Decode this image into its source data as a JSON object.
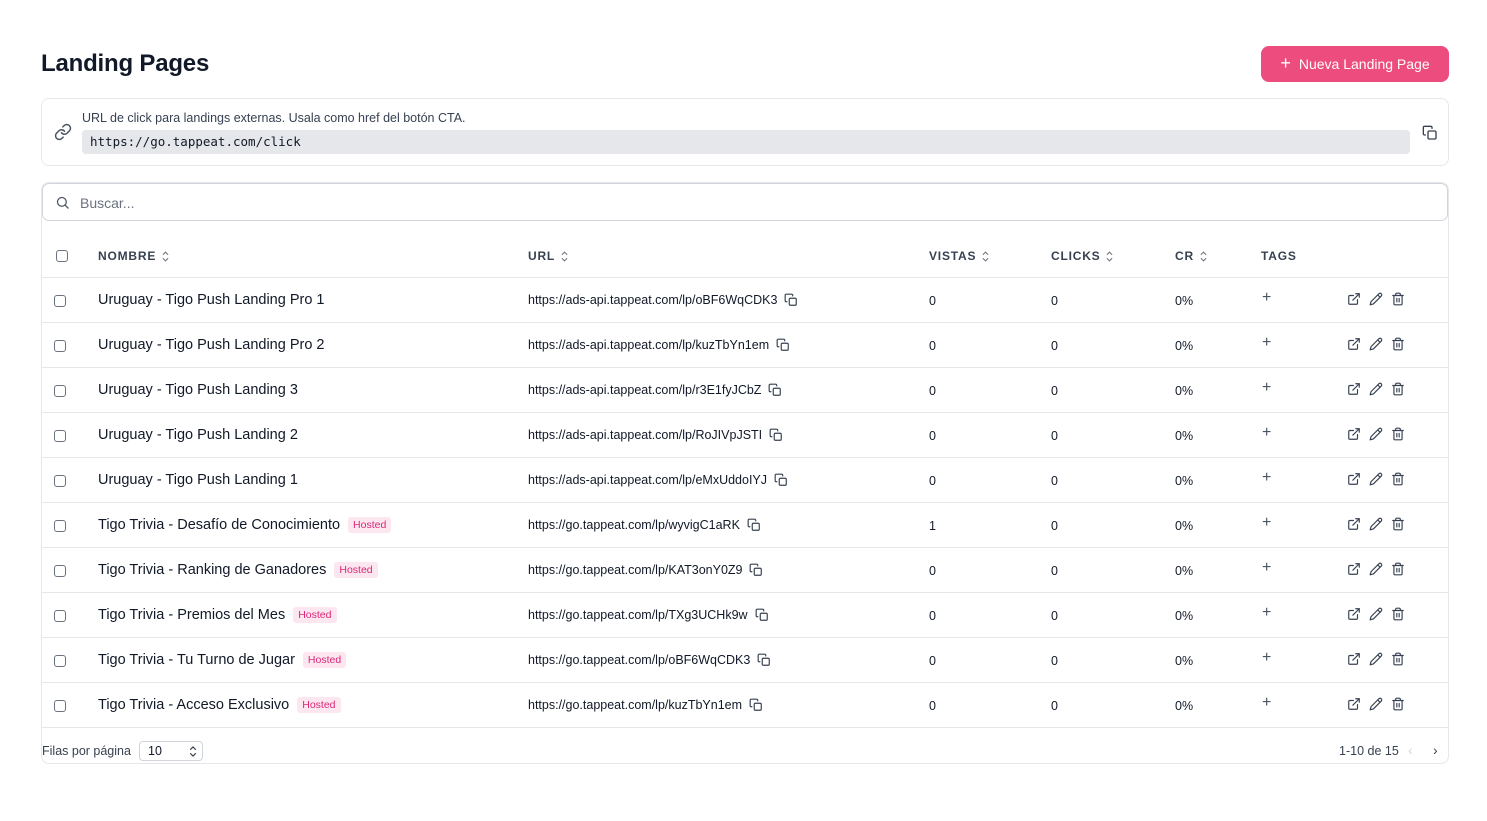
{
  "header": {
    "title": "Landing Pages",
    "new_button_label": "Nueva Landing Page"
  },
  "click_url_card": {
    "hint": "URL de click para landings externas. Usala como href del botón CTA.",
    "url": "https://go.tappeat.com/click"
  },
  "search": {
    "placeholder": "Buscar..."
  },
  "columns": {
    "name": "NOMBRE",
    "url": "URL",
    "views": "VISTAS",
    "clicks": "CLICKS",
    "cr": "CR",
    "tags": "TAGS"
  },
  "rows": [
    {
      "name": "Uruguay - Tigo Push Landing Pro 1",
      "badge": "",
      "url": "https://ads-api.tappeat.com/lp/oBF6WqCDK3",
      "views": "0",
      "clicks": "0",
      "cr": "0%"
    },
    {
      "name": "Uruguay - Tigo Push Landing Pro 2",
      "badge": "",
      "url": "https://ads-api.tappeat.com/lp/kuzTbYn1em",
      "views": "0",
      "clicks": "0",
      "cr": "0%"
    },
    {
      "name": "Uruguay - Tigo Push Landing 3",
      "badge": "",
      "url": "https://ads-api.tappeat.com/lp/r3E1fyJCbZ",
      "views": "0",
      "clicks": "0",
      "cr": "0%"
    },
    {
      "name": "Uruguay - Tigo Push Landing 2",
      "badge": "",
      "url": "https://ads-api.tappeat.com/lp/RoJIVpJSTI",
      "views": "0",
      "clicks": "0",
      "cr": "0%"
    },
    {
      "name": "Uruguay - Tigo Push Landing 1",
      "badge": "",
      "url": "https://ads-api.tappeat.com/lp/eMxUddoIYJ",
      "views": "0",
      "clicks": "0",
      "cr": "0%"
    },
    {
      "name": "Tigo Trivia - Desafío de Conocimiento",
      "badge": "Hosted",
      "url": "https://go.tappeat.com/lp/wyvigC1aRK",
      "views": "1",
      "clicks": "0",
      "cr": "0%"
    },
    {
      "name": "Tigo Trivia - Ranking de Ganadores",
      "badge": "Hosted",
      "url": "https://go.tappeat.com/lp/KAT3onY0Z9",
      "views": "0",
      "clicks": "0",
      "cr": "0%"
    },
    {
      "name": "Tigo Trivia - Premios del Mes",
      "badge": "Hosted",
      "url": "https://go.tappeat.com/lp/TXg3UCHk9w",
      "views": "0",
      "clicks": "0",
      "cr": "0%"
    },
    {
      "name": "Tigo Trivia - Tu Turno de Jugar",
      "badge": "Hosted",
      "url": "https://go.tappeat.com/lp/oBF6WqCDK3",
      "views": "0",
      "clicks": "0",
      "cr": "0%"
    },
    {
      "name": "Tigo Trivia - Acceso Exclusivo",
      "badge": "Hosted",
      "url": "https://go.tappeat.com/lp/kuzTbYn1em",
      "views": "0",
      "clicks": "0",
      "cr": "0%"
    }
  ],
  "footer": {
    "rows_per_page_label": "Filas por página",
    "rows_per_page_value": "10",
    "range": "1-10 de 15",
    "prev": "‹",
    "next": "›"
  },
  "icons": {
    "add_icon": "+",
    "link": "link-icon",
    "copy": "copy-icon",
    "search": "search-icon",
    "sort": "sort-icon",
    "external": "external-link-icon",
    "edit": "pencil-icon",
    "delete": "trash-icon"
  },
  "colors": {
    "accent": "#ec4d7e",
    "badge_text": "#db2777",
    "badge_bg": "#fce7f1",
    "border": "#e5e7eb"
  }
}
